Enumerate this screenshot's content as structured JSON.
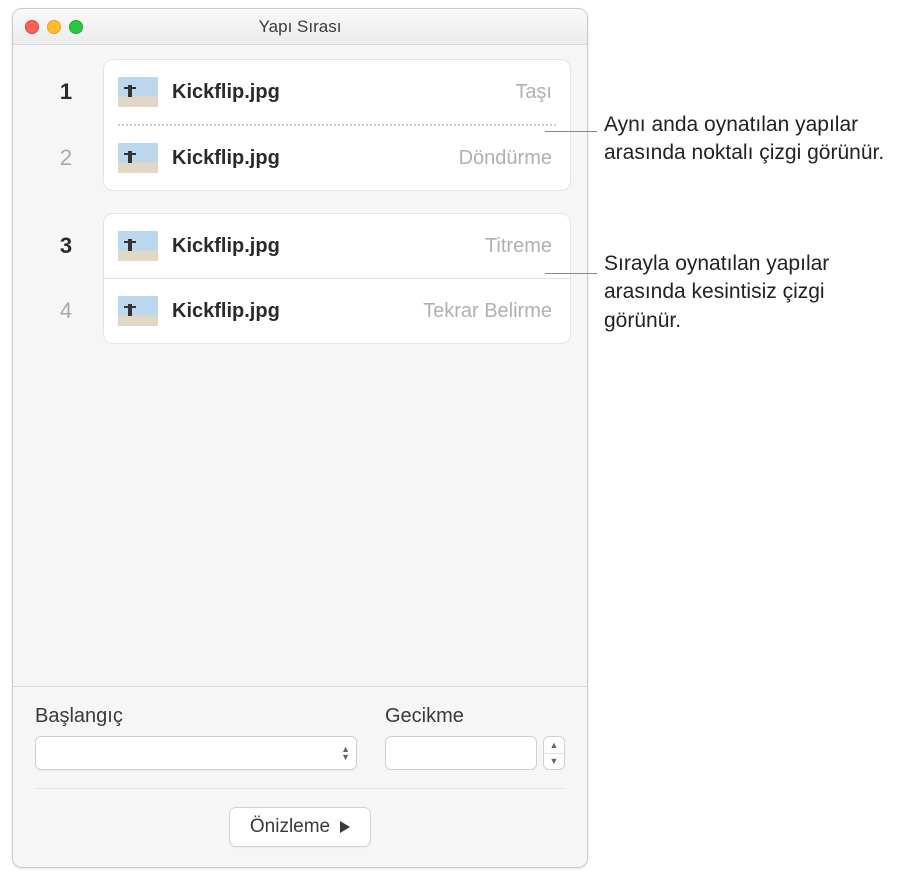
{
  "window": {
    "title": "Yapı Sırası"
  },
  "builds": [
    {
      "num": "1",
      "dim": false,
      "file": "Kickflip.jpg",
      "effect": "Taşı"
    },
    {
      "num": "2",
      "dim": true,
      "file": "Kickflip.jpg",
      "effect": "Döndürme"
    },
    {
      "num": "3",
      "dim": false,
      "file": "Kickflip.jpg",
      "effect": "Titreme"
    },
    {
      "num": "4",
      "dim": true,
      "file": "Kickflip.jpg",
      "effect": "Tekrar Belirme"
    }
  ],
  "controls": {
    "start_label": "Başlangıç",
    "delay_label": "Gecikme",
    "start_value": "",
    "delay_value": ""
  },
  "preview": {
    "label": "Önizleme"
  },
  "callouts": {
    "c1": "Aynı anda oynatılan yapılar arasında noktalı çizgi görünür.",
    "c2": "Sırayla oynatılan yapılar arasında kesintisiz çizgi görünür."
  }
}
